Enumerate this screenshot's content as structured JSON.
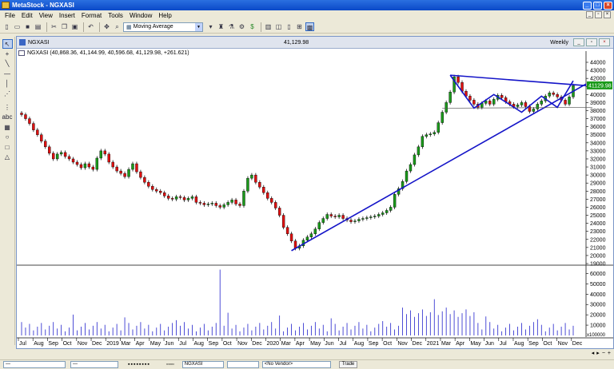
{
  "window": {
    "title": "MetaStock - NGXASI",
    "app_icon": "metastock-icon"
  },
  "menu": [
    "File",
    "Edit",
    "View",
    "Insert",
    "Format",
    "Tools",
    "Window",
    "Help"
  ],
  "toolbar": {
    "indicator_combo": "Moving Average",
    "left_icons": [
      "new-icon",
      "open-icon",
      "save-icon",
      "print-icon",
      "cut-icon",
      "copy-icon",
      "paste-icon",
      "undo-icon",
      "crosshair-icon",
      "zoom-icon"
    ],
    "right_icons": [
      "indicator-builder-icon",
      "expert-icon",
      "explorer-icon",
      "system-tester-icon",
      "dollar-icon",
      "tile-icon",
      "cascade-icon",
      "layout-icon",
      "grid-icon",
      "chart-icon"
    ]
  },
  "left_tools": [
    "pointer-icon",
    "crosshair-tool-icon",
    "trendline-icon",
    "horizontal-line-icon",
    "vertical-line-icon",
    "fibonacci-icon",
    "gap",
    "cycles-icon",
    "text-tool-icon",
    "grid-tool-icon",
    "ellipse-tool-icon",
    "rectangle-tool-icon",
    "triangle-tool-icon"
  ],
  "chart_window": {
    "security": "NGXASI",
    "last_price": "41,129.98",
    "periodicity": "Weekly",
    "legend": "NGXASI (40,868.36, 41,144.99, 40,596.68, 41,129.98, +261.621)",
    "price_tag": "41129.98"
  },
  "status": {
    "combo": "NGXASI",
    "vendor": "<No Vendor>",
    "trade": "Trade"
  },
  "chart_data": {
    "type": "candlestick",
    "price_axis": {
      "labels": [
        "44000",
        "43000",
        "42000",
        "41000",
        "40000",
        "39000",
        "38000",
        "37000",
        "36000",
        "35000",
        "34000",
        "33000",
        "32000",
        "31000",
        "30000",
        "29000",
        "28000",
        "27000",
        "26000",
        "25000",
        "24000",
        "23000",
        "22000",
        "21000",
        "20000",
        "19000"
      ],
      "min": 19000,
      "max": 44000
    },
    "volume_axis": {
      "labels": [
        "60000",
        "50000",
        "40000",
        "30000",
        "20000",
        "10000"
      ],
      "multiplier": "x100000",
      "max": 65000
    },
    "x_labels": [
      "Jul",
      "Aug",
      "Sep",
      "Oct",
      "Nov",
      "Dec",
      "2019",
      "Mar",
      "Apr",
      "May",
      "Jun",
      "Jul",
      "Aug",
      "Sep",
      "Oct",
      "Nov",
      "Dec",
      "2020",
      "Mar",
      "Apr",
      "May",
      "Jun",
      "Jul",
      "Aug",
      "Sep",
      "Oct",
      "Nov",
      "Dec",
      "2021",
      "Mar",
      "Apr",
      "May",
      "Jun",
      "Jul",
      "Aug",
      "Sep",
      "Oct",
      "Nov",
      "Dec"
    ],
    "price_close": [
      37500,
      37000,
      36400,
      35600,
      35000,
      34200,
      33500,
      32700,
      32000,
      32600,
      32800,
      32300,
      32000,
      31600,
      31300,
      30900,
      31400,
      31000,
      30700,
      32100,
      33000,
      32600,
      31600,
      31000,
      30500,
      30200,
      29800,
      30700,
      31400,
      30400,
      29700,
      29100,
      28600,
      28200,
      28000,
      27800,
      27400,
      27100,
      27000,
      27300,
      27200,
      26900,
      27100,
      27300,
      26600,
      26500,
      26300,
      26400,
      26500,
      26200,
      26000,
      26300,
      26600,
      26900,
      26400,
      26200,
      28000,
      29600,
      30000,
      29100,
      28500,
      27800,
      27100,
      26600,
      25900,
      25000,
      23500,
      22700,
      21800,
      20900,
      21200,
      21900,
      22300,
      22700,
      23300,
      24100,
      24600,
      25100,
      24900,
      24800,
      25000,
      24600,
      24400,
      24200,
      24300,
      24500,
      24600,
      24700,
      24800,
      24900,
      25100,
      25300,
      25600,
      26000,
      27600,
      28300,
      29200,
      30500,
      31300,
      32500,
      33500,
      34800,
      35000,
      35100,
      35300,
      36500,
      37800,
      39000,
      40300,
      42200,
      41500,
      40400,
      39800,
      39300,
      38800,
      38400,
      38900,
      39200,
      38800,
      39400,
      39900,
      39600,
      39100,
      38800,
      38500,
      38700,
      39000,
      38500,
      37900,
      38200,
      38800,
      39200,
      39800,
      40200,
      40000,
      39700,
      39300,
      38800,
      39700,
      41100
    ]
  }
}
